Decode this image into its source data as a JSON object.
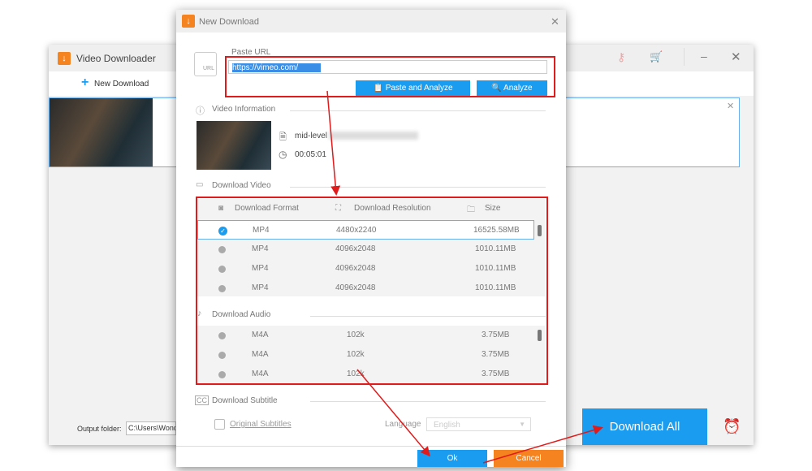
{
  "main_window": {
    "title": "Video Downloader",
    "new_download": "New Download",
    "output_label": "Output folder:",
    "output_path": "C:\\Users\\Wonder",
    "download_all": "Download All"
  },
  "dialog": {
    "title": "New Download",
    "paste_url_label": "Paste URL",
    "url_value": "https://vimeo.com/",
    "paste_analyze": "Paste and Analyze",
    "analyze": "Analyze",
    "video_info_label": "Video Information",
    "video_title": "mid-level",
    "duration": "00:05:01",
    "download_video_label": "Download Video",
    "columns": [
      "Download Format",
      "Download Resolution",
      "Size"
    ],
    "video_rows": [
      {
        "format": "MP4",
        "resolution": "4480x2240",
        "size": "16525.58MB",
        "selected": true
      },
      {
        "format": "MP4",
        "resolution": "4096x2048",
        "size": "1010.11MB",
        "selected": false
      },
      {
        "format": "MP4",
        "resolution": "4096x2048",
        "size": "1010.11MB",
        "selected": false
      },
      {
        "format": "MP4",
        "resolution": "4096x2048",
        "size": "1010.11MB",
        "selected": false
      }
    ],
    "download_audio_label": "Download Audio",
    "audio_rows": [
      {
        "format": "M4A",
        "bitrate": "102k",
        "size": "3.75MB"
      },
      {
        "format": "M4A",
        "bitrate": "102k",
        "size": "3.75MB"
      },
      {
        "format": "M4A",
        "bitrate": "102k",
        "size": "3.75MB"
      }
    ],
    "download_subtitle_label": "Download Subtitle",
    "original_subtitles": "Original Subtitles",
    "language_label": "Language",
    "language_value": "English",
    "ok": "Ok",
    "cancel": "Cancel"
  },
  "colors": {
    "accent": "#1a9cf0",
    "cancel": "#f5831f",
    "annotation": "#e01b1b"
  }
}
